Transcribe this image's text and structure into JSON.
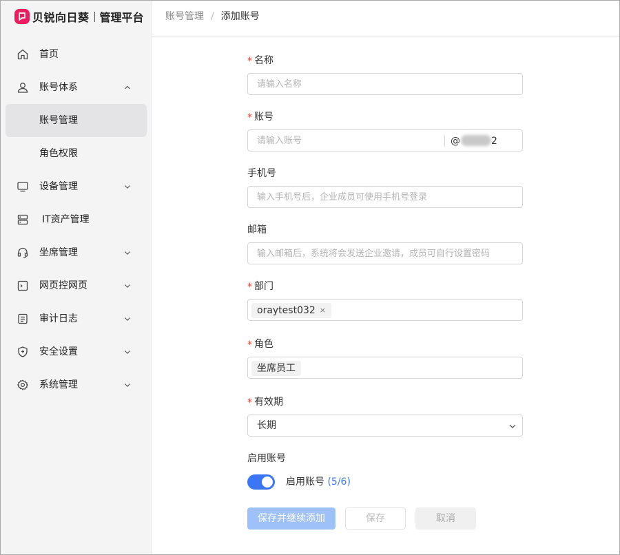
{
  "brand": {
    "name": "贝锐向日葵",
    "subtitle": "管理平台",
    "logo_icon": "sunlogin-logo-icon",
    "accent": "#ee1c5f"
  },
  "breadcrumb": {
    "parent": "账号管理",
    "separator": "/",
    "current": "添加账号"
  },
  "sidebar": {
    "items": [
      {
        "label": "首页",
        "icon": "home-icon"
      },
      {
        "label": "账号体系",
        "icon": "user-icon",
        "expanded": true
      },
      {
        "label": "账号管理",
        "active": true
      },
      {
        "label": "角色权限"
      },
      {
        "label": "设备管理",
        "icon": "monitor-icon"
      },
      {
        "label": "IT资产管理",
        "icon": "server-icon"
      },
      {
        "label": "坐席管理",
        "icon": "headset-icon"
      },
      {
        "label": "网页控网页",
        "icon": "web-terminal-icon"
      },
      {
        "label": "审计日志",
        "icon": "log-icon"
      },
      {
        "label": "安全设置",
        "icon": "shield-icon"
      },
      {
        "label": "系统管理",
        "icon": "gear-icon"
      }
    ]
  },
  "form": {
    "name": {
      "label": "名称",
      "required": true,
      "placeholder": "请输入名称"
    },
    "account": {
      "label": "账号",
      "required": true,
      "placeholder": "请输入账号",
      "suffix_start": "@",
      "suffix_end": "2"
    },
    "phone": {
      "label": "手机号",
      "placeholder": "输入手机号后，企业成员可使用手机号登录"
    },
    "email": {
      "label": "邮箱",
      "placeholder": "输入邮箱后，系统将会发送企业邀请，成员可自行设置密码"
    },
    "department": {
      "label": "部门",
      "required": true,
      "tags": [
        "oraytest032"
      ],
      "remove_icon": "×"
    },
    "role": {
      "label": "角色",
      "required": true,
      "tags": [
        "坐席员工"
      ]
    },
    "validity": {
      "label": "有效期",
      "required": true,
      "value": "长期"
    },
    "enable": {
      "label": "启用账号",
      "toggle_text": "启用账号",
      "count": "(5/6)",
      "enabled": true,
      "accent": "#3b76f6"
    },
    "required_mark": "*"
  },
  "buttons": {
    "save_continue": "保存并继续添加",
    "save": "保存",
    "cancel": "取消"
  }
}
